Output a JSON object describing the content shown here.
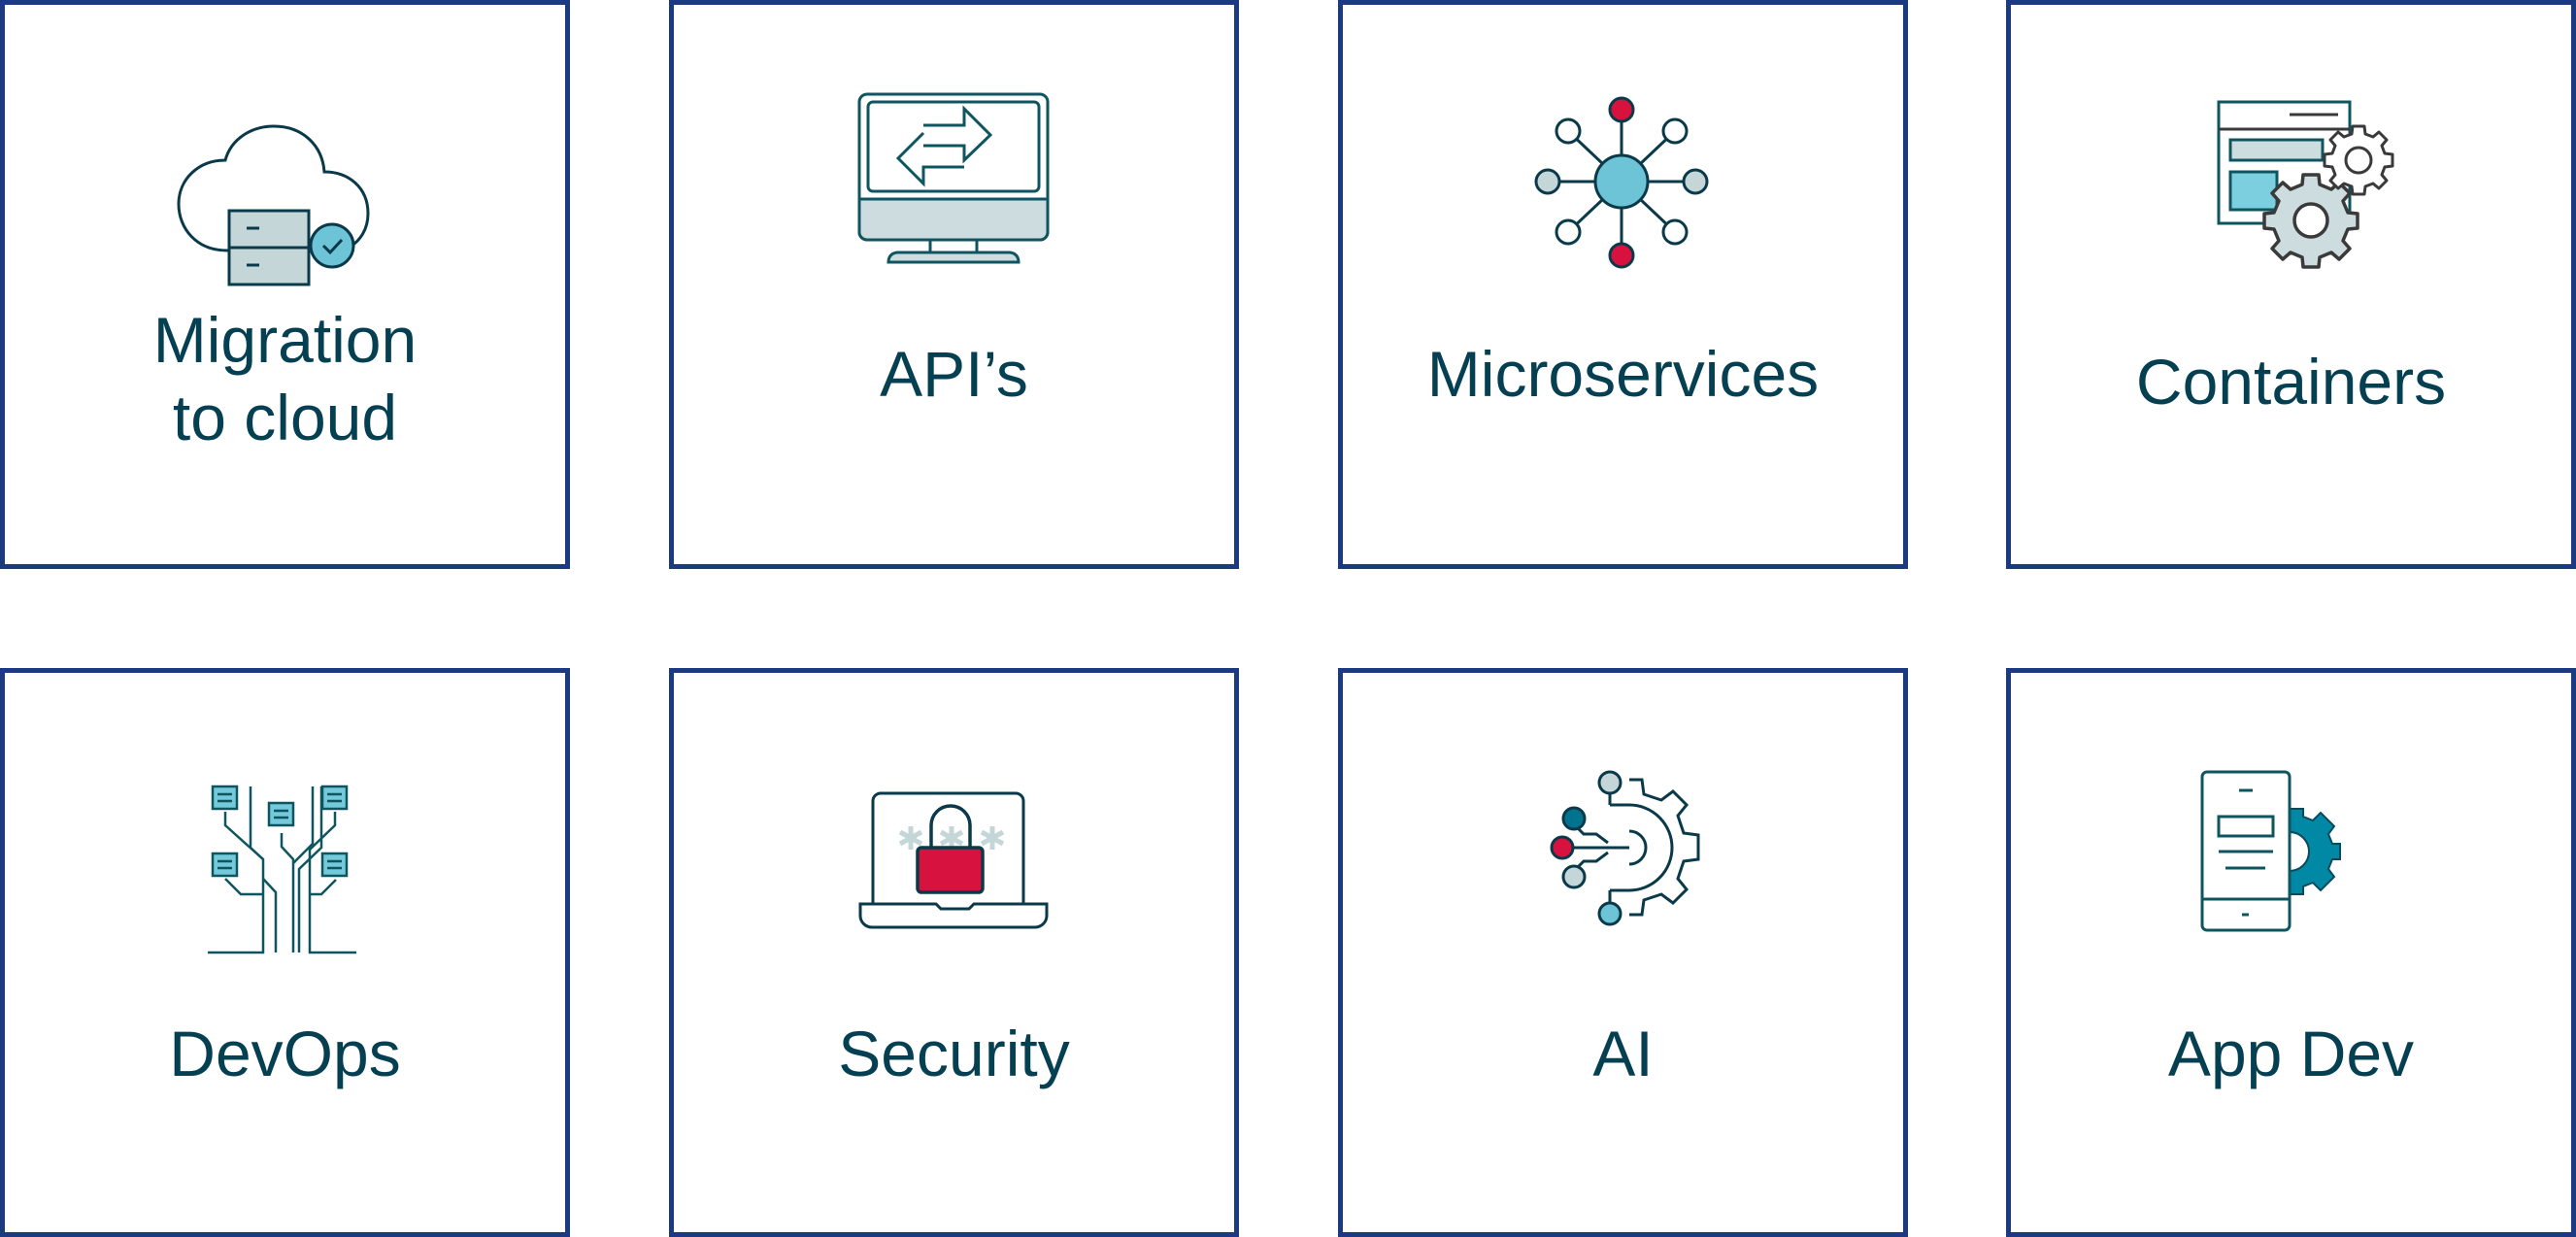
{
  "theme": {
    "border_color": "#1b3a82",
    "text_color": "#053f52",
    "stroke_dark": "#0a3a4a",
    "stroke_teal": "#0f5560",
    "fill_light_gray": "#c5d6d9",
    "fill_light_blue": "#6cc4d6",
    "fill_red": "#d7123e",
    "fill_dark_teal": "#00748f",
    "fill_gear_teal": "#0088a5"
  },
  "cards": [
    {
      "id": "migration",
      "label_lines": [
        "Migration",
        "to cloud"
      ],
      "icon": "cloud-server-check-icon"
    },
    {
      "id": "apis",
      "label_lines": [
        "API’s"
      ],
      "icon": "monitor-exchange-arrows-icon"
    },
    {
      "id": "microservices",
      "label_lines": [
        "Microservices"
      ],
      "icon": "hub-network-icon"
    },
    {
      "id": "containers",
      "label_lines": [
        "Containers"
      ],
      "icon": "window-gears-icon"
    },
    {
      "id": "devops",
      "label_lines": [
        "DevOps"
      ],
      "icon": "circuit-tree-icon"
    },
    {
      "id": "security",
      "label_lines": [
        "Security"
      ],
      "icon": "laptop-padlock-icon"
    },
    {
      "id": "ai",
      "label_lines": [
        "AI"
      ],
      "icon": "ai-gear-nodes-icon"
    },
    {
      "id": "appdev",
      "label_lines": [
        "App Dev"
      ],
      "icon": "mobile-gear-icon"
    }
  ]
}
